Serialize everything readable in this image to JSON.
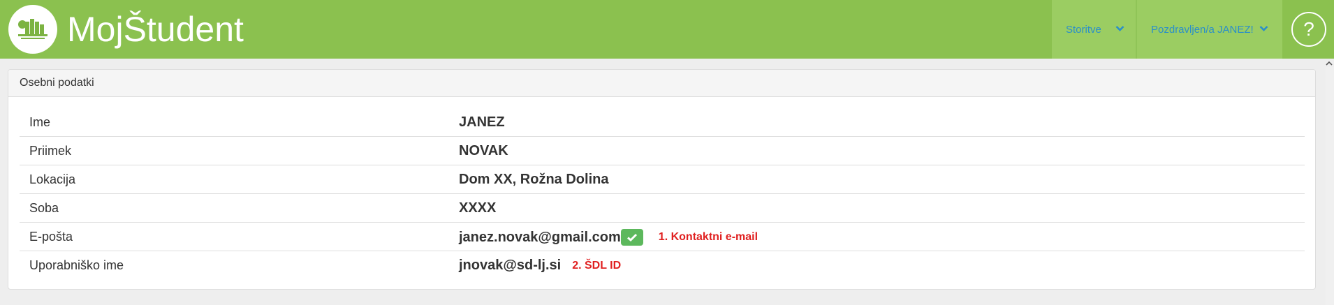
{
  "navbar": {
    "brand": "MojŠtudent",
    "menu_services": "Storitve",
    "menu_user": "Pozdravljen/a JANEZ!",
    "help": "?"
  },
  "panel": {
    "title": "Osebni podatki",
    "rows": [
      {
        "label": "Ime",
        "value": "JANEZ"
      },
      {
        "label": "Priimek",
        "value": "NOVAK"
      },
      {
        "label": "Lokacija",
        "value": "Dom XX, Rožna Dolina"
      },
      {
        "label": "Soba",
        "value": "XXXX"
      },
      {
        "label": "E-pošta",
        "value": "janez.novak@gmail.com",
        "note": "1. Kontaktni e-mail"
      },
      {
        "label": "Uporabniško ime",
        "value": "jnovak@sd-lj.si",
        "note": "2. ŠDL ID"
      }
    ]
  },
  "colors": {
    "navbar": "#8bc14f",
    "nav_item": "#9bcd62",
    "link": "#2a8fc9",
    "verified": "#5cb85c",
    "annotation": "#e02020"
  },
  "icons": [
    "logo",
    "chevron-down-icon",
    "help-icon",
    "check-icon"
  ]
}
